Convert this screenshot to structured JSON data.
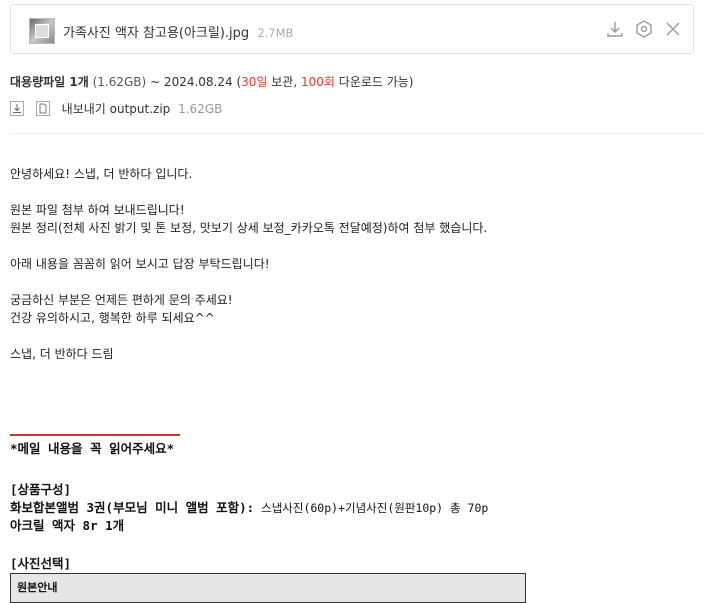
{
  "attachment": {
    "file_name": "가족사진 액자 참고용(아크릴).jpg",
    "file_size": "2.7MB",
    "icons": [
      "download-icon",
      "scan-icon",
      "close-icon"
    ]
  },
  "bulk": {
    "title": "대용량파일 1개",
    "size": "(1.62GB)",
    "date_prefix": "~ 2024.08.24 (",
    "days": "30일",
    "keep": " 보관, ",
    "count": "100회",
    "suffix": " 다운로드 가능)",
    "zip_label": "내보내기 output.zip",
    "zip_size": "1.62GB"
  },
  "body": {
    "greeting": "안녕하세요! 스냅, 더 반하다 입니다.",
    "line1": "원본 파일 첨부 하여 보내드립니다!",
    "line2": "원본 정리(전체 사진 밝기 및 톤 보정, 맛보기 상세 보정_카카오톡 전달예정)하여 첨부 했습니다.",
    "line3": "아래 내용을 꼼꼼히 읽어 보시고 답장 부탁드립니다!",
    "line4": "궁금하신 부분은 언제든 편하게 문의 주세요!",
    "line5": "건강 유의하시고, 행복한 하루 되세요^^",
    "sign": "스냅, 더 반하다 드림",
    "notice": "*메일 내용을 꼭 읽어주세요*",
    "product_header": "[상품구성]",
    "product_line1_bold": "화보합본앨범 3권(부모님 미니 앨범 포함):",
    "product_line1_rest": " 스냅사진(60p)+기념사진(원판10p) 총 70p",
    "product_line2": "아크릴 액자 8r 1개",
    "photo_header": "[사진선택]",
    "table_header": "원본안내"
  },
  "colors": {
    "accent_red": "#e03c31",
    "table_bg": "#e6e6e6"
  }
}
